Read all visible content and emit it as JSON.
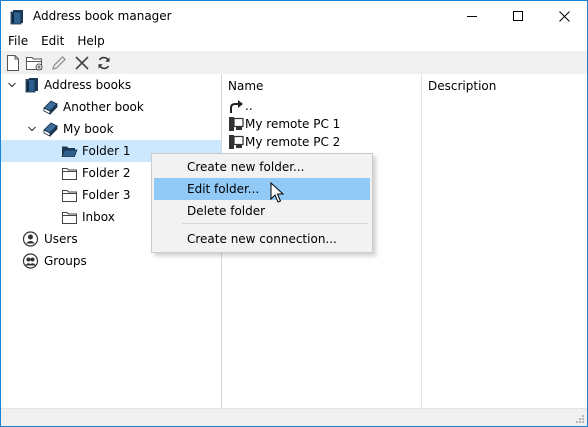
{
  "window": {
    "title": "Address book manager",
    "app_icon": "address-book-icon",
    "controls": [
      "minimize-icon",
      "maximize-icon",
      "close-icon"
    ]
  },
  "menu": [
    "File",
    "Edit",
    "Help"
  ],
  "toolbar": {
    "buttons": [
      {
        "name": "new-document-icon"
      },
      {
        "name": "new-folder-icon"
      },
      {
        "name": "edit-pencil-icon"
      },
      {
        "name": "delete-x-icon"
      },
      {
        "name": "refresh-icon"
      }
    ]
  },
  "tree": {
    "items": [
      {
        "label": "Address books",
        "icon": "address-books-icon",
        "expanded": true
      },
      {
        "label": "Another book",
        "icon": "book-icon"
      },
      {
        "label": "My book",
        "icon": "book-icon",
        "expanded": true
      },
      {
        "label": "Folder 1",
        "icon": "folder-icon",
        "selected": true
      },
      {
        "label": "Folder 2",
        "icon": "folder-icon"
      },
      {
        "label": "Folder 3",
        "icon": "folder-icon"
      },
      {
        "label": "Inbox",
        "icon": "folder-icon"
      },
      {
        "label": "Users",
        "icon": "user-icon"
      },
      {
        "label": "Groups",
        "icon": "group-icon"
      }
    ]
  },
  "list": {
    "columns": [
      "Name",
      "Description"
    ],
    "rows": [
      {
        "name": "..",
        "icon": "up-arrow-icon"
      },
      {
        "name": "My remote PC 1",
        "icon": "remote-pc-icon"
      },
      {
        "name": "My remote PC 2",
        "icon": "remote-pc-icon"
      }
    ]
  },
  "context_menu": {
    "items": [
      {
        "label": "Create new folder...",
        "hover": false
      },
      {
        "label": "Edit folder...",
        "hover": true
      },
      {
        "label": "Delete folder",
        "hover": false
      },
      {
        "label": "Create new connection...",
        "hover": false
      }
    ],
    "hover_color": "#91c9f7"
  },
  "colors": {
    "selection": "#cce8ff",
    "window_border": "#1883d7",
    "toolbar_bg": "#f0f0f0"
  }
}
